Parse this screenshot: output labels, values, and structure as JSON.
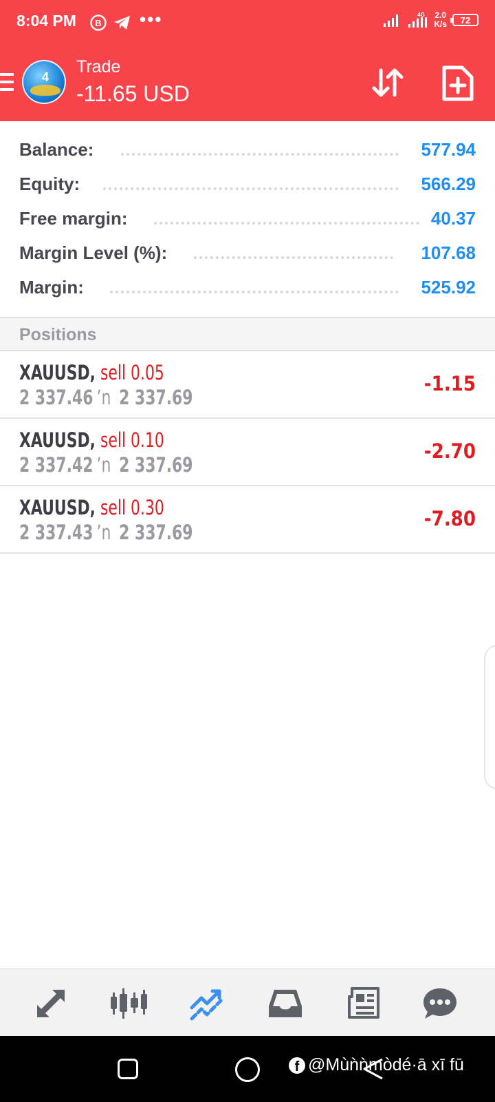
{
  "status_bar": {
    "time": "8:04 PM",
    "network_type": "4G",
    "net_speed_value": "2.0",
    "net_speed_unit": "K/s",
    "battery": "72"
  },
  "header": {
    "title": "Trade",
    "profit": "-11.65 USD"
  },
  "account": [
    {
      "label": "Balance:",
      "value": "577.94"
    },
    {
      "label": "Equity:",
      "value": "566.29"
    },
    {
      "label": "Free margin:",
      "value": "40.37"
    },
    {
      "label": "Margin Level (%):",
      "value": "107.68"
    },
    {
      "label": "Margin:",
      "value": "525.92"
    }
  ],
  "positions": {
    "header": "Positions",
    "rows": [
      {
        "symbol": "XAUUSD,",
        "type": "sell 0.05",
        "open_price": "2 337.46",
        "arrow": "ʼn",
        "current_price": "2 337.69",
        "profit": "-1.15"
      },
      {
        "symbol": "XAUUSD,",
        "type": "sell 0.10",
        "open_price": "2 337.42",
        "arrow": "ʼn",
        "current_price": "2 337.69",
        "profit": "-2.70"
      },
      {
        "symbol": "XAUUSD,",
        "type": "sell 0.30",
        "open_price": "2 337.43",
        "arrow": "ʼn",
        "current_price": "2 337.69",
        "profit": "-7.80"
      }
    ]
  },
  "bottom_nav": [
    "quotes-icon",
    "chart-icon",
    "trade-icon",
    "history-icon",
    "news-icon",
    "chat-icon"
  ],
  "colors": {
    "header_bg": "#f9434a",
    "value_blue": "#1f8ef2",
    "loss_red": "#e01c22",
    "active_nav": "#3b8ff0"
  },
  "watermark": {
    "text": "@Mùǹǹmòdé·ā xī fū"
  }
}
